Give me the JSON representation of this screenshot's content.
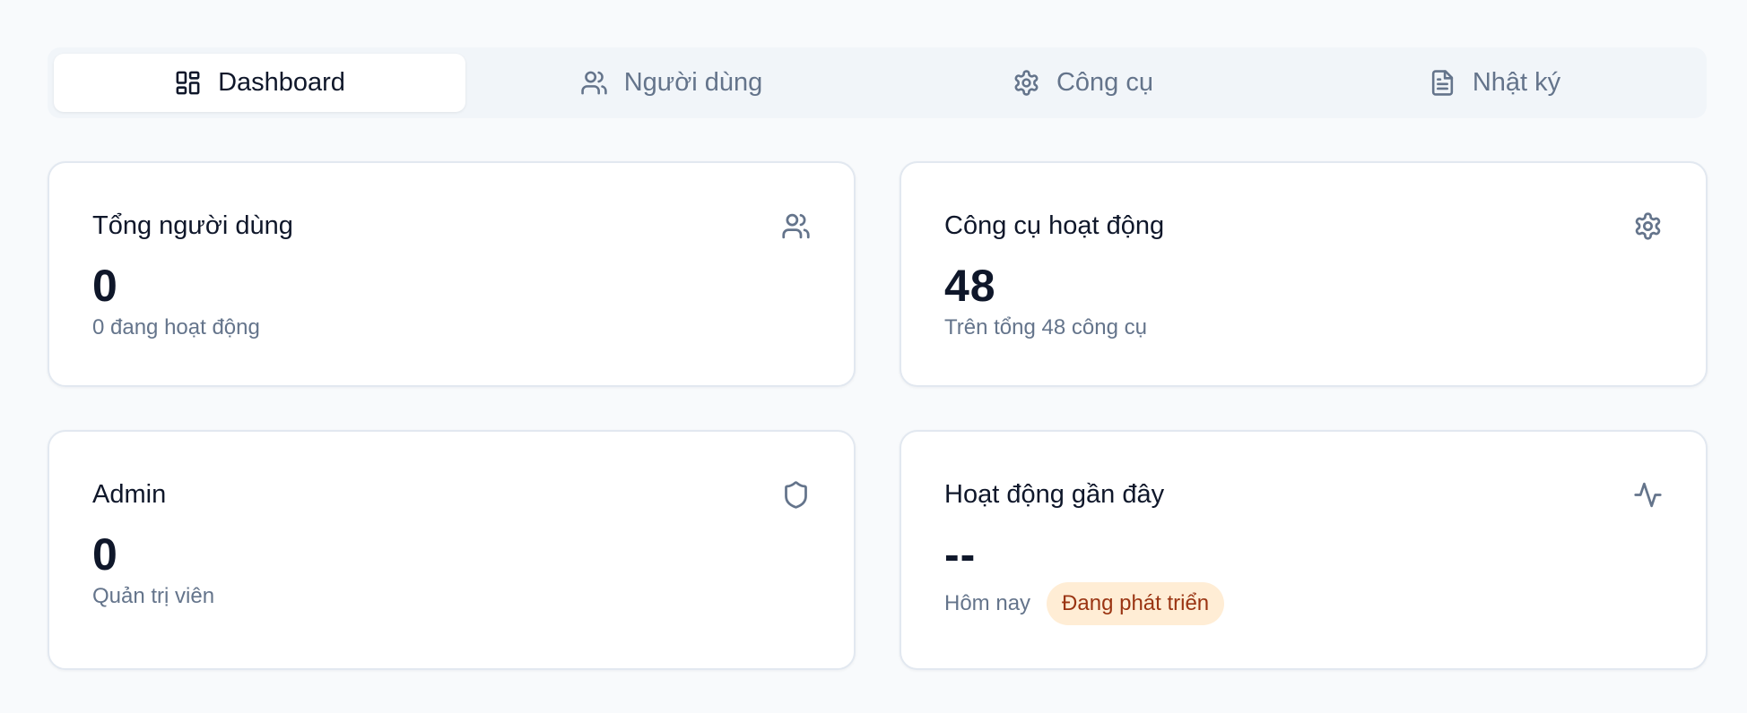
{
  "tabs": [
    {
      "label": "Dashboard",
      "icon": "dashboard-icon",
      "active": true
    },
    {
      "label": "Người dùng",
      "icon": "users-icon",
      "active": false
    },
    {
      "label": "Công cụ",
      "icon": "gear-icon",
      "active": false
    },
    {
      "label": "Nhật ký",
      "icon": "file-text-icon",
      "active": false
    }
  ],
  "cards": {
    "total_users": {
      "title": "Tổng người dùng",
      "value": "0",
      "sub": "0 đang hoạt động",
      "icon": "users-icon"
    },
    "active_tools": {
      "title": "Công cụ hoạt động",
      "value": "48",
      "sub": "Trên tổng 48 công cụ",
      "icon": "gear-icon"
    },
    "admin": {
      "title": "Admin",
      "value": "0",
      "sub": "Quản trị viên",
      "icon": "shield-icon"
    },
    "recent_activity": {
      "title": "Hoạt động gần đây",
      "value": "--",
      "sub": "Hôm nay",
      "badge": "Đang phát triển",
      "icon": "activity-icon"
    }
  },
  "colors": {
    "background": "#f8fafc",
    "badge_bg": "#ffedd5",
    "badge_text": "#9a3412",
    "muted_text": "#64748b"
  }
}
